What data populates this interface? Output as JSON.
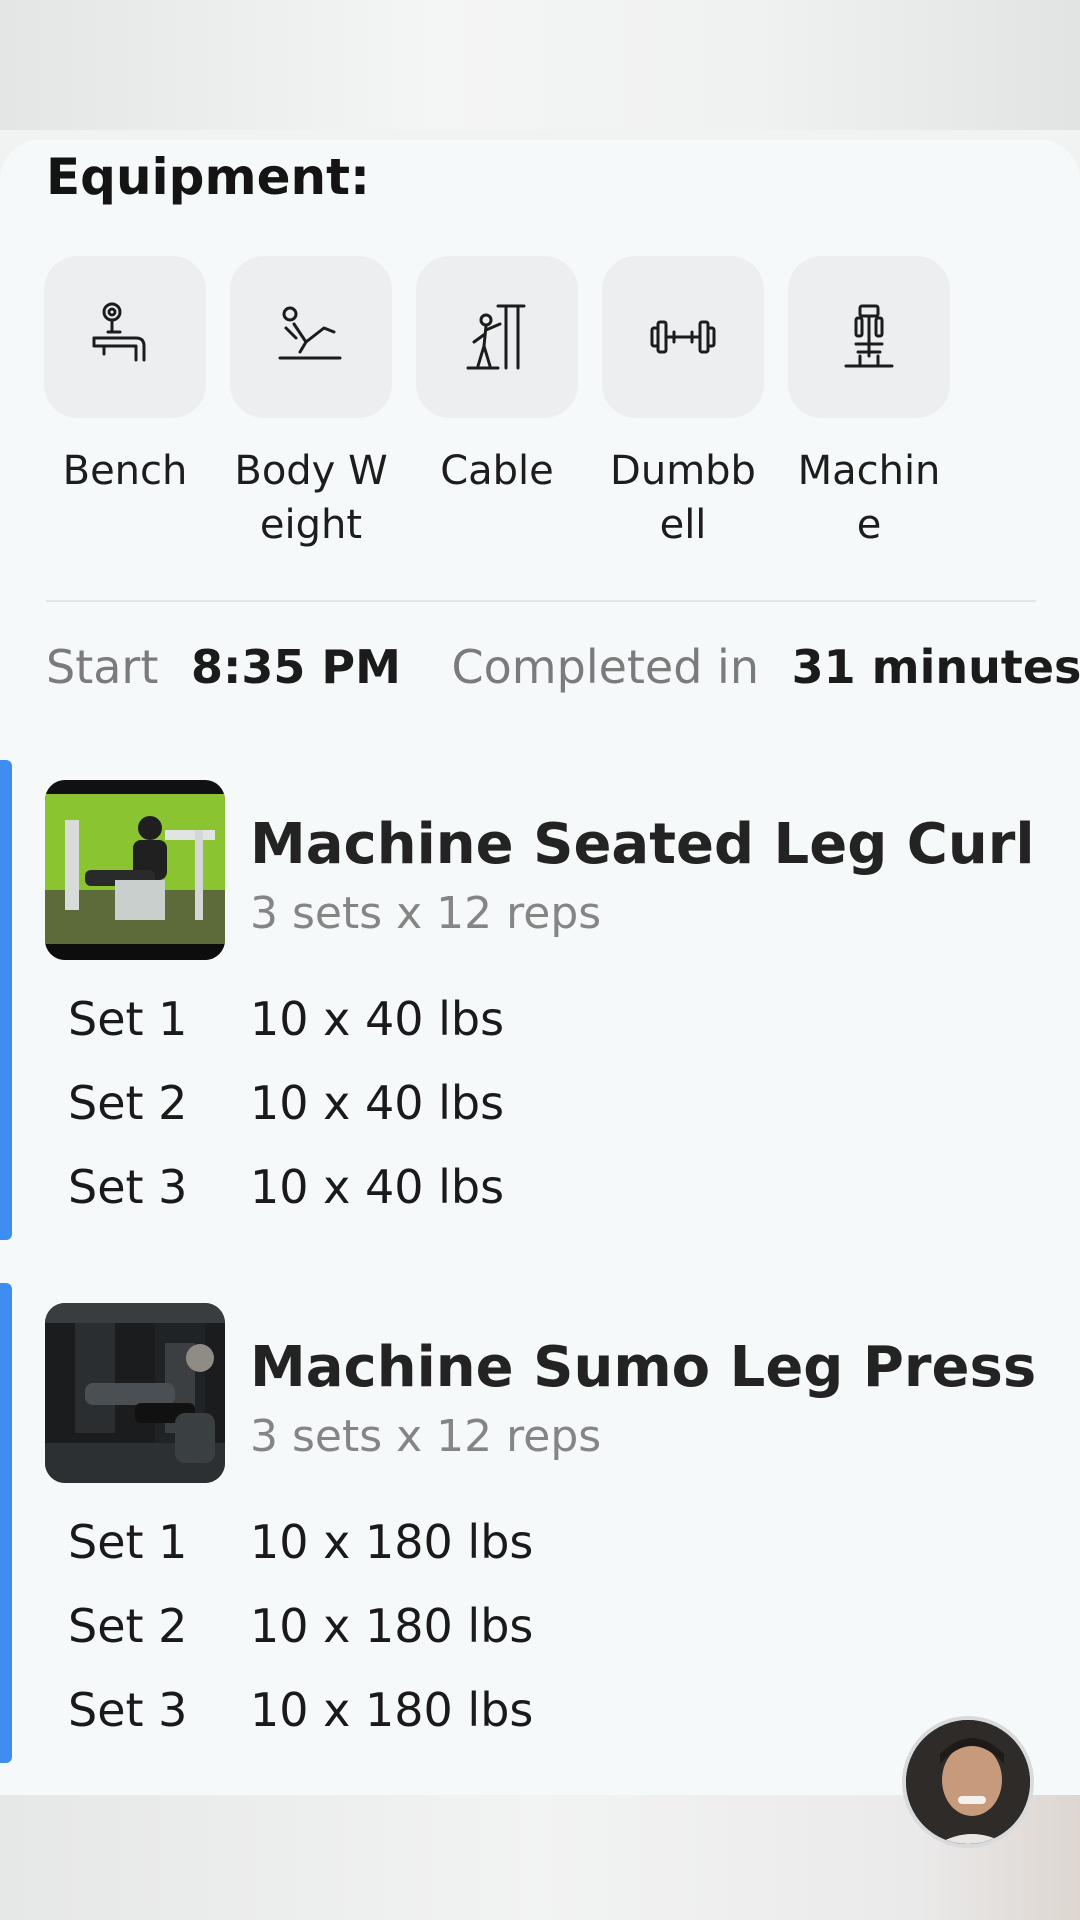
{
  "equipment": {
    "title": "Equipment:",
    "items": [
      {
        "label": "Bench",
        "icon": "bench-icon"
      },
      {
        "label": "Body Weight",
        "icon": "body-weight-icon"
      },
      {
        "label": "Cable",
        "icon": "cable-icon"
      },
      {
        "label": "Dumbbell",
        "icon": "dumbbell-icon"
      },
      {
        "label": "Machine",
        "icon": "machine-icon"
      }
    ]
  },
  "summary": {
    "start_label": "Start",
    "start_time": "8:35 PM",
    "completed_label": "Completed in",
    "duration": "31 minutes"
  },
  "exercises": [
    {
      "name": "Machine Seated Leg Curl",
      "plan": "3 sets x 12 reps",
      "sets": [
        {
          "label": "Set 1",
          "value": "10 x 40 lbs"
        },
        {
          "label": "Set 2",
          "value": "10 x 40 lbs"
        },
        {
          "label": "Set 3",
          "value": "10 x 40 lbs"
        }
      ]
    },
    {
      "name": "Machine Sumo Leg Press",
      "plan": "3 sets x 12 reps",
      "sets": [
        {
          "label": "Set 1",
          "value": "10 x 180 lbs"
        },
        {
          "label": "Set 2",
          "value": "10 x 180 lbs"
        },
        {
          "label": "Set 3",
          "value": "10 x 180 lbs"
        }
      ]
    }
  ],
  "colors": {
    "accent": "#3d8ef0",
    "background": "#f6f9fa",
    "tile": "#eceeef"
  }
}
